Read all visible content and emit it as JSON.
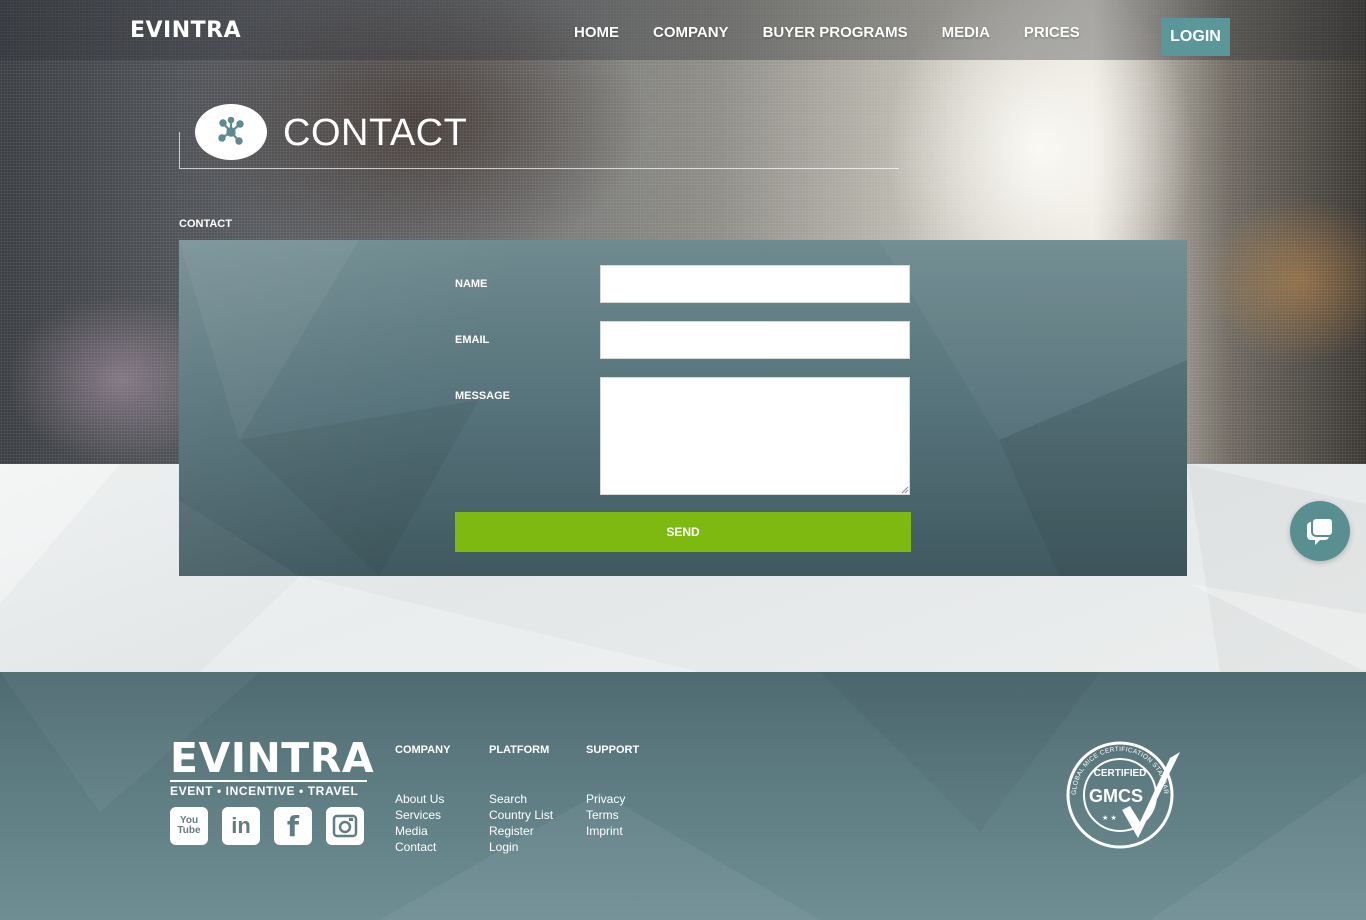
{
  "brand": {
    "name": "EVINTRA"
  },
  "nav": {
    "items": [
      "HOME",
      "COMPANY",
      "BUYER PROGRAMS",
      "MEDIA",
      "PRICES"
    ],
    "login_label": "LOGIN"
  },
  "page": {
    "title": "CONTACT",
    "icon": "network-nodes-icon",
    "section_label": "CONTACT"
  },
  "form": {
    "name_label": "NAME",
    "email_label": "EMAIL",
    "message_label": "MESSAGE",
    "name_value": "",
    "email_value": "",
    "message_value": "",
    "send_label": "SEND"
  },
  "chat": {
    "icon": "chat-bubble-icon"
  },
  "footer": {
    "logo": "EVINTRA",
    "tagline": "EVENT • INCENTIVE • TRAVEL",
    "social_icons": [
      "youtube-icon",
      "linkedin-icon",
      "facebook-icon",
      "instagram-icon"
    ],
    "social_youtube_top": "You",
    "social_youtube_bottom": "Tube",
    "social_linkedin": "in",
    "social_facebook": "f",
    "columns": [
      {
        "heading": "COMPANY",
        "links": [
          "About Us",
          "Services",
          "Media",
          "Contact"
        ]
      },
      {
        "heading": "PLATFORM",
        "links": [
          "Search",
          "Country List",
          "Register",
          "Login"
        ]
      },
      {
        "heading": "SUPPORT",
        "links": [
          "Privacy",
          "Terms",
          "Imprint"
        ]
      }
    ],
    "badge": {
      "main": "GMCS",
      "certified": "CERTIFIED",
      "ring_text": "GLOBAL MICE CERTIFICATION STANDARD"
    }
  },
  "colors": {
    "accent_teal": "#5b9799",
    "send_green": "#7db910",
    "panel": "#56727a",
    "footer": "#5f7e84"
  }
}
